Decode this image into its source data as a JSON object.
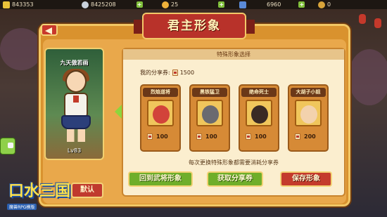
{
  "resources": [
    {
      "icon": "gold-ingot-icon",
      "value": "843353"
    },
    {
      "icon": "silver-coin-icon",
      "value": "8425208"
    },
    {
      "icon": "energy-icon",
      "value": "25"
    },
    {
      "icon": "gem-icon",
      "value": "6960"
    },
    {
      "icon": "medal-icon",
      "value": "0"
    }
  ],
  "title": "君主形象",
  "character": {
    "name": "九天傲若画",
    "level": "Lv83"
  },
  "default_button": "默认",
  "special": {
    "header": "特殊形象选择",
    "shares_label": "我的分享券:",
    "shares_value": "1500",
    "cards": [
      {
        "name": "烈焰道将",
        "price": "100"
      },
      {
        "name": "黑铁猛卫",
        "price": "100"
      },
      {
        "name": "绝命死士",
        "price": "100"
      },
      {
        "name": "大胡子小姐",
        "price": "200"
      }
    ],
    "note": "每次更换特殊形象都需要消耗分享券"
  },
  "buttons": {
    "return": "回到武将形象",
    "get_coupons": "获取分享券",
    "save": "保存形象"
  },
  "logo": {
    "text": "口水三国",
    "sub": "魔兽RPG模版"
  }
}
